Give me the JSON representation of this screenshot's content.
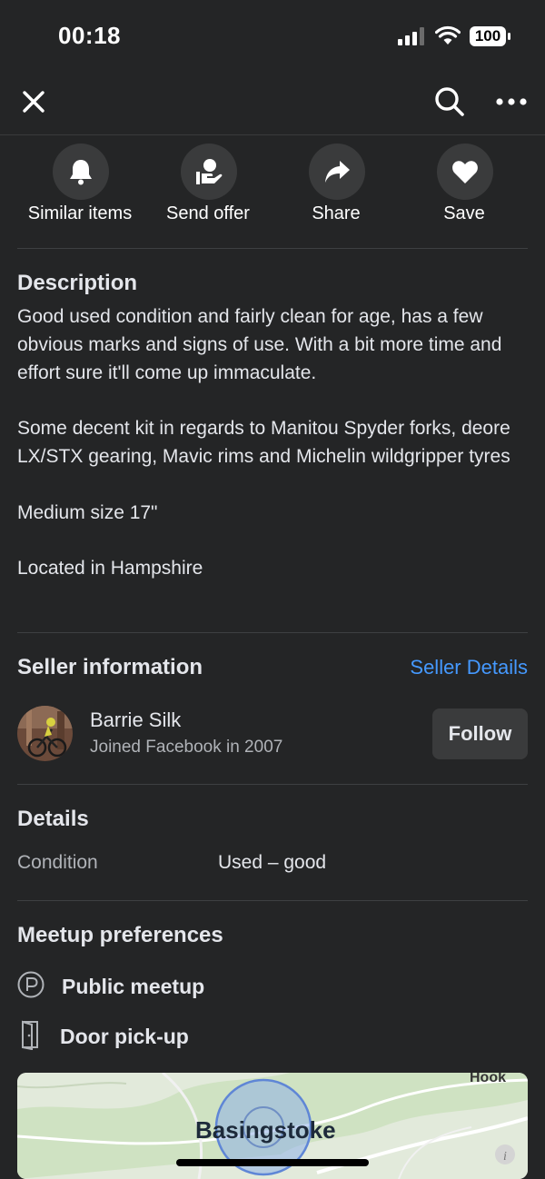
{
  "status_bar": {
    "time": "00:18",
    "battery": "100"
  },
  "actions": [
    {
      "label": "Similar items",
      "icon": "bell-icon"
    },
    {
      "label": "Send offer",
      "icon": "offer-hand-icon"
    },
    {
      "label": "Share",
      "icon": "share-arrow-icon"
    },
    {
      "label": "Save",
      "icon": "heart-icon"
    }
  ],
  "description": {
    "title": "Description",
    "text": "Good used condition and fairly clean for age, has a few obvious marks and signs of use. With a bit more time and effort sure it'll come up immaculate.\n\nSome decent kit in regards to Manitou Spyder forks, deore LX/STX gearing, Mavic rims and Michelin wildgripper tyres\n\nMedium size 17\"\n\nLocated in Hampshire"
  },
  "seller": {
    "title": "Seller information",
    "details_link": "Seller Details",
    "name": "Barrie Silk",
    "joined": "Joined Facebook in 2007",
    "follow_label": "Follow"
  },
  "details": {
    "title": "Details",
    "condition_label": "Condition",
    "condition_value": "Used – good"
  },
  "meetup": {
    "title": "Meetup preferences",
    "options": [
      {
        "label": "Public meetup",
        "icon": "parking-p-icon"
      },
      {
        "label": "Door pick-up",
        "icon": "door-icon"
      }
    ]
  },
  "map": {
    "city": "Basingstoke",
    "town": "Hook"
  },
  "colors": {
    "background": "#242526",
    "link": "#4599ff",
    "button": "#3a3b3c"
  }
}
